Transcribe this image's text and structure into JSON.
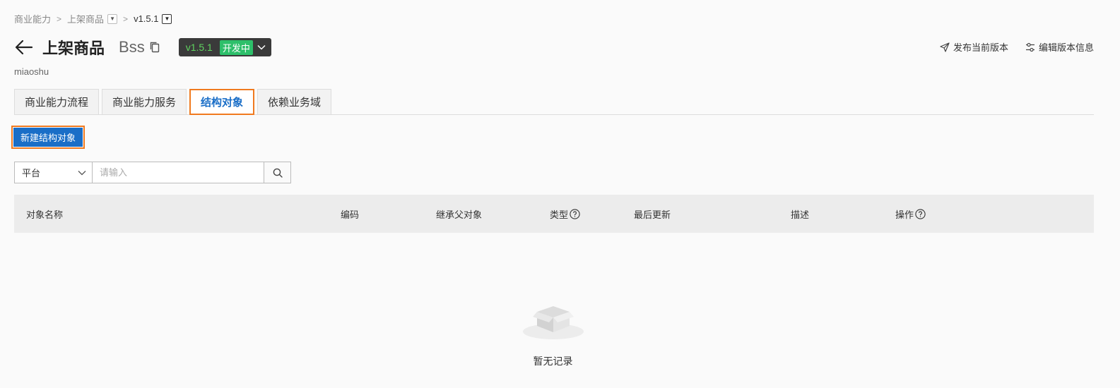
{
  "breadcrumb": {
    "items": [
      "商业能力",
      "上架商品",
      "v1.5.1"
    ]
  },
  "header": {
    "title": "上架商品",
    "code": "Bss",
    "version": "v1.5.1",
    "version_status": "开发中",
    "description": "miaoshu"
  },
  "actions": {
    "publish": "发布当前版本",
    "edit_version": "编辑版本信息"
  },
  "tabs": [
    {
      "label": "商业能力流程",
      "active": false
    },
    {
      "label": "商业能力服务",
      "active": false
    },
    {
      "label": "结构对象",
      "active": true
    },
    {
      "label": "依赖业务域",
      "active": false
    }
  ],
  "toolbar": {
    "new_button": "新建结构对象"
  },
  "search": {
    "scope": "平台",
    "placeholder": "请输入"
  },
  "table": {
    "columns": [
      "对象名称",
      "编码",
      "继承父对象",
      "类型",
      "最后更新",
      "描述",
      "操作"
    ]
  },
  "empty": {
    "text": "暂无记录"
  },
  "colors": {
    "primary": "#1a6ec7",
    "highlight": "#f07a1f",
    "status_green": "#2dbf6a"
  }
}
